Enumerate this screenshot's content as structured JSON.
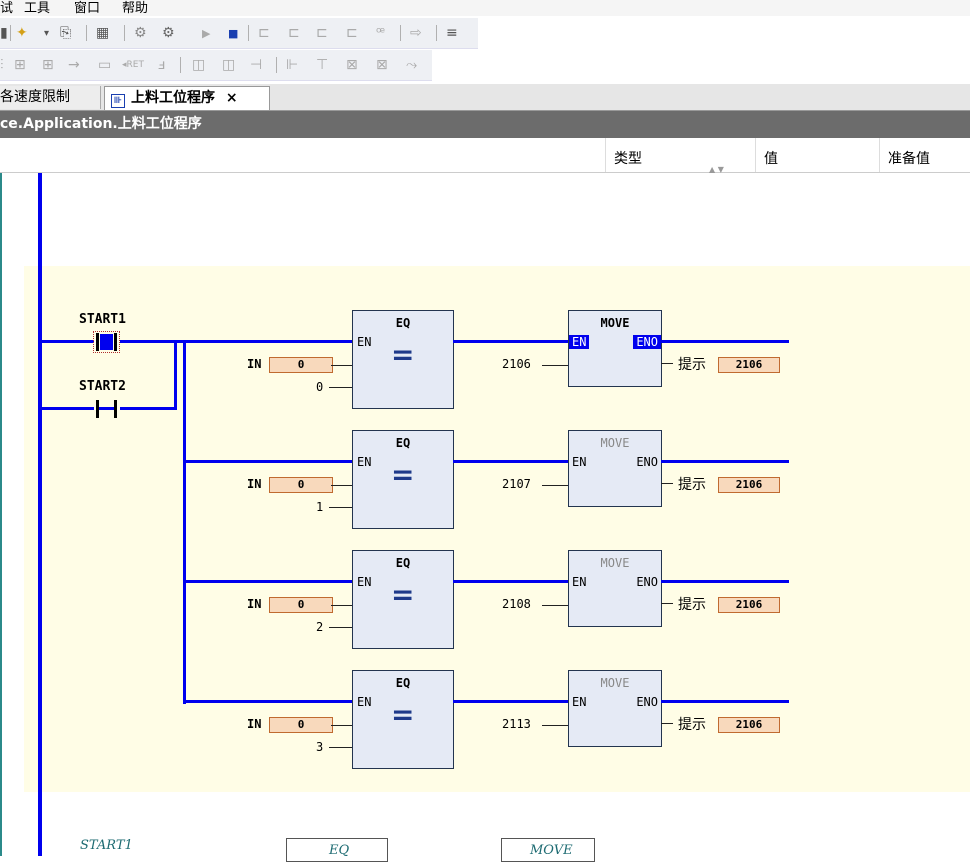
{
  "menu": [
    "试",
    "工具",
    "窗口",
    "帮助"
  ],
  "tabs": [
    {
      "label": "各速度限制",
      "active": false
    },
    {
      "label": "上料工位程序",
      "active": true,
      "close": "×"
    }
  ],
  "path": "ce.Application.上料工位程序",
  "columns": [
    "类型",
    "值",
    "准备值"
  ],
  "ladder": {
    "contacts": [
      {
        "label": "START1"
      },
      {
        "label": "START2"
      }
    ],
    "rows": [
      {
        "eq_title": "EQ",
        "en": "EN",
        "eq_sym": "=",
        "in_label": "IN",
        "in_value": "0",
        "cmp": "0",
        "move_title": "MOVE",
        "move_en": "EN",
        "move_eno": "ENO",
        "move_in": "2106",
        "out_label": "提示",
        "out_value": "2106",
        "move_active": true
      },
      {
        "eq_title": "EQ",
        "en": "EN",
        "eq_sym": "=",
        "in_label": "IN",
        "in_value": "0",
        "cmp": "1",
        "move_title": "MOVE",
        "move_en": "EN",
        "move_eno": "ENO",
        "move_in": "2107",
        "out_label": "提示",
        "out_value": "2106",
        "move_active": false
      },
      {
        "eq_title": "EQ",
        "en": "EN",
        "eq_sym": "=",
        "in_label": "IN",
        "in_value": "0",
        "cmp": "2",
        "move_title": "MOVE",
        "move_en": "EN",
        "move_eno": "ENO",
        "move_in": "2108",
        "out_label": "提示",
        "out_value": "2106",
        "move_active": false
      },
      {
        "eq_title": "EQ",
        "en": "EN",
        "eq_sym": "=",
        "in_label": "IN",
        "in_value": "0",
        "cmp": "3",
        "move_title": "MOVE",
        "move_en": "EN",
        "move_eno": "ENO",
        "move_in": "2113",
        "out_label": "提示",
        "out_value": "2106",
        "move_active": false
      }
    ]
  },
  "fbd": {
    "contact": "START1",
    "eq": "EQ",
    "move": "MOVE"
  },
  "colors": {
    "wire": "#0000ee",
    "network_bg": "#fffde6",
    "value_bg": "#f8d9bc",
    "block_bg": "#e5eaf5",
    "path_bg": "#6c6c6c"
  }
}
